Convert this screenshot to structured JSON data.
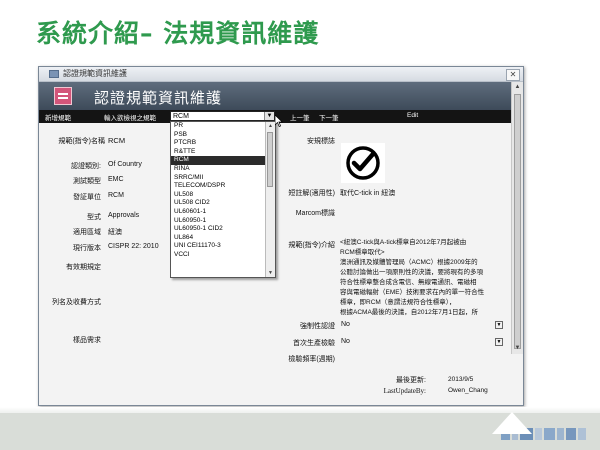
{
  "slide": {
    "title": "系統介紹– 法規資訊維護",
    "accent_color": "#2f9a4e"
  },
  "window": {
    "title": "認證規範資訊維護",
    "close_icon": "close-icon",
    "form_title": "認證規範資訊維護"
  },
  "toolbar": {
    "new_label": "新增規範",
    "search_label": "輸入欲檢視之規範",
    "combo_value": "RCM",
    "prev_label": "上一筆",
    "next_label": "下一筆",
    "edit_label": "Edit"
  },
  "dropdown": {
    "options": [
      "PR",
      "PSB",
      "PTCRB",
      "R&TTE",
      "RCM",
      "RINA",
      "SRRC/MII",
      "TELECOM/DSPR",
      "UL508",
      "UL508 CID2",
      "UL60601-1",
      "UL60950-1",
      "UL60950-1 CID2",
      "UL864",
      "UNI CEI11170-3",
      "VCCI"
    ],
    "selected": "RCM"
  },
  "form": {
    "regulation_label": "規範(指令)名稱",
    "regulation_value": "RCM",
    "cert_type_label": "認證類別:",
    "cert_type_value": "Of Country",
    "test_type_label": "測試類型",
    "test_type_value": "EMC",
    "issuer_label": "發証單位",
    "issuer_value": "RCM",
    "format_label": "型式",
    "format_value": "Approvals",
    "region_label": "適用區域",
    "region_value": "紐澳",
    "version_label": "現行版本",
    "version_value": "CISPR 22: 2010",
    "validity_label": "有效期規定",
    "listing_label": "列名及收費方式",
    "sample_label": "樣品需求",
    "mark_label": "安規標誌",
    "short_label": "短註解(適用性)",
    "short_value": "取代C-tick in 紐澳",
    "marcom_label": "Marcom標識",
    "intro_label": "規範(指令)介紹",
    "intro_text": [
      "<紐澳C-tick與A-tick標章自2012年7月起被由",
      "RCM標章取代>",
      "澳洲通訊及媒體管理局（ACMC）根據2009年的",
      "公聽討論做出一項原則性的決議，要將現有的多項",
      "符合性標章整合成含電信、無線電通訊、電磁相",
      "容與電磁輻射（EME）技術要求在內的單一符合性",
      "標章，即RCM（意謂法規符合性標章），",
      "根據ACMA最後的決議，自2012年7月1日起，所"
    ],
    "mandatory_label": "強制性認證",
    "mandatory_value": "No",
    "first_prod_label": "首次生產檢驗",
    "first_prod_value": "No",
    "inspection_label": "檢驗頻率(週期)",
    "last_update_label": "最後更新:",
    "last_update_value": "2013/9/5",
    "last_update_by_label": "LastUpdateBy:",
    "last_update_by_value": "Owen_Chang"
  },
  "icons": {
    "rcm_mark": "rcm-check-mark-icon",
    "form_icon": "form-icon",
    "cursor": "mouse-pointer-icon"
  }
}
